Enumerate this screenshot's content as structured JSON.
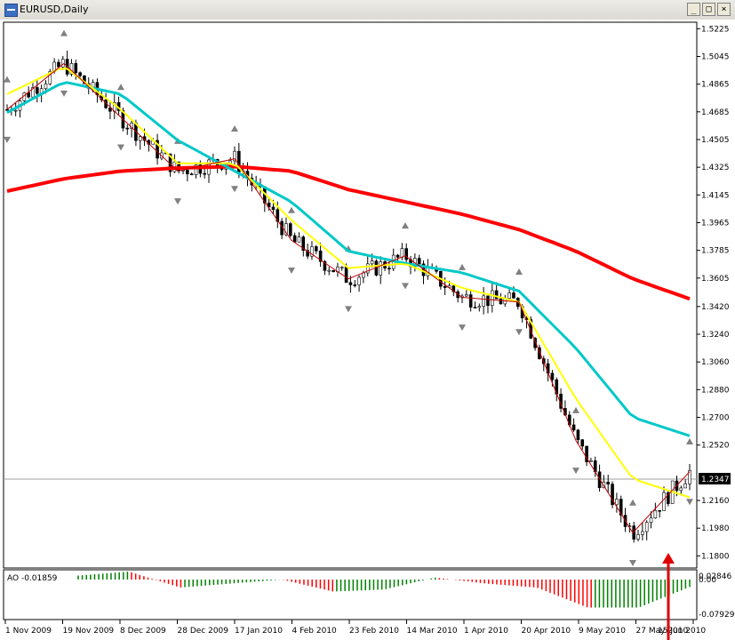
{
  "window": {
    "title": "EURUSD,Daily",
    "buttons": {
      "minimize": "_",
      "maximize": "□",
      "close": "×"
    }
  },
  "indicator": {
    "label": "AO -0.01859",
    "scale_top": "0.02846",
    "scale_mid": "0.00",
    "scale_bottom": "-0.07929"
  },
  "price_axis": {
    "labels": [
      "1.5225",
      "1.5045",
      "1.4865",
      "1.4685",
      "1.4505",
      "1.4325",
      "1.4145",
      "1.3965",
      "1.3785",
      "1.3605",
      "1.3420",
      "1.3240",
      "1.3060",
      "1.2880",
      "1.2700",
      "1.2520",
      "1.2160",
      "1.1980",
      "1.1800"
    ],
    "current_price": "1.2347"
  },
  "time_axis": {
    "labels": [
      "1 Nov 2009",
      "19 Nov 2009",
      "8 Dec 2009",
      "28 Dec 2009",
      "17 Jan 2010",
      "4 Feb 2010",
      "23 Feb 2010",
      "14 Mar 2010",
      "1 Apr 2010",
      "20 Apr 2010",
      "9 May 2010",
      "27 May 2010",
      "15 Jun 2010"
    ]
  },
  "colors": {
    "background": "#ffffff",
    "bull_candle": "#ffffff",
    "bear_candle": "#000000",
    "ma_fast": "#ffff00",
    "ma_mid": "#00c8c8",
    "ma_slow": "#ff0000",
    "zigzag": "#c00000",
    "ao_up": "#008000",
    "ao_down": "#ff0000",
    "fractal": "#808080",
    "arrow": "#e00000"
  },
  "chart_data": {
    "type": "candlestick",
    "symbol": "EURUSD",
    "timeframe": "Daily",
    "ylim": [
      1.175,
      1.525
    ],
    "x": [
      "1 Nov 2009",
      "19 Nov 2009",
      "8 Dec 2009",
      "28 Dec 2009",
      "17 Jan 2010",
      "4 Feb 2010",
      "23 Feb 2010",
      "14 Mar 2010",
      "1 Apr 2010",
      "20 Apr 2010",
      "9 May 2010",
      "27 May 2010",
      "15 Jun 2010"
    ],
    "close": [
      1.47,
      1.5,
      1.465,
      1.43,
      1.438,
      1.385,
      1.36,
      1.375,
      1.348,
      1.345,
      1.255,
      1.195,
      1.2347
    ],
    "series": [
      {
        "values": [
          1.48,
          1.498,
          1.47,
          1.435,
          1.435,
          1.398,
          1.367,
          1.37,
          1.354,
          1.345,
          1.282,
          1.23,
          1.218
        ]
      },
      {
        "values": [
          1.468,
          1.488,
          1.48,
          1.45,
          1.43,
          1.41,
          1.378,
          1.37,
          1.364,
          1.352,
          1.315,
          1.27,
          1.258
        ]
      },
      {
        "values": [
          1.417,
          1.425,
          1.43,
          1.432,
          1.433,
          1.43,
          1.418,
          1.41,
          1.402,
          1.392,
          1.378,
          1.36,
          1.347
        ]
      }
    ],
    "ao": [
      0.01,
      0.02,
      -0.02,
      -0.01,
      0.0,
      -0.03,
      -0.025,
      0.005,
      -0.01,
      -0.02,
      -0.07,
      -0.07,
      -0.0186
    ],
    "grid": false
  }
}
